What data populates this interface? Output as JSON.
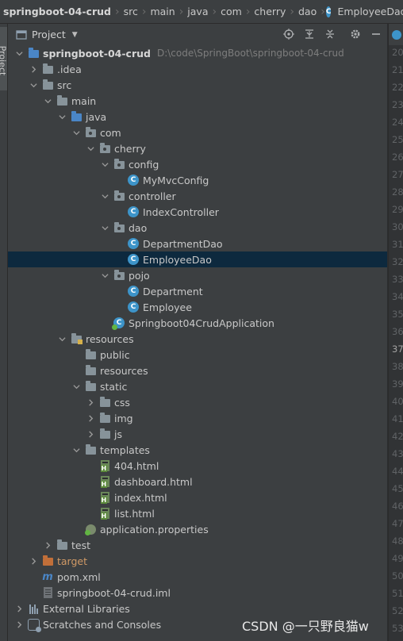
{
  "breadcrumb": [
    "springboot-04-crud",
    "src",
    "main",
    "java",
    "com",
    "cherry",
    "dao",
    "EmployeeDao"
  ],
  "tool_window": {
    "strip_label": "Project",
    "title": "Project"
  },
  "tree": [
    {
      "label": "springboot-04-crud",
      "path": "D:\\code\\SpringBoot\\springboot-04-crud",
      "depth": 0,
      "arrow": "down",
      "icon": "module-folder-icon",
      "bold": true
    },
    {
      "label": ".idea",
      "depth": 1,
      "arrow": "right",
      "icon": "folder-icon"
    },
    {
      "label": "src",
      "depth": 1,
      "arrow": "down",
      "icon": "folder-icon"
    },
    {
      "label": "main",
      "depth": 2,
      "arrow": "down",
      "icon": "folder-icon"
    },
    {
      "label": "java",
      "depth": 3,
      "arrow": "down",
      "icon": "source-folder-icon"
    },
    {
      "label": "com",
      "depth": 4,
      "arrow": "down",
      "icon": "package-icon"
    },
    {
      "label": "cherry",
      "depth": 5,
      "arrow": "down",
      "icon": "package-icon"
    },
    {
      "label": "config",
      "depth": 6,
      "arrow": "down",
      "icon": "package-icon"
    },
    {
      "label": "MyMvcConfig",
      "depth": 7,
      "arrow": "none",
      "icon": "class-icon"
    },
    {
      "label": "controller",
      "depth": 6,
      "arrow": "down",
      "icon": "package-icon"
    },
    {
      "label": "IndexController",
      "depth": 7,
      "arrow": "none",
      "icon": "class-icon"
    },
    {
      "label": "dao",
      "depth": 6,
      "arrow": "down",
      "icon": "package-icon"
    },
    {
      "label": "DepartmentDao",
      "depth": 7,
      "arrow": "none",
      "icon": "class-icon"
    },
    {
      "label": "EmployeeDao",
      "depth": 7,
      "arrow": "none",
      "icon": "class-icon",
      "selected": true
    },
    {
      "label": "pojo",
      "depth": 6,
      "arrow": "down",
      "icon": "package-icon"
    },
    {
      "label": "Department",
      "depth": 7,
      "arrow": "none",
      "icon": "class-icon"
    },
    {
      "label": "Employee",
      "depth": 7,
      "arrow": "none",
      "icon": "class-icon"
    },
    {
      "label": "Springboot04CrudApplication",
      "depth": 6,
      "arrow": "none",
      "icon": "spring-app-icon"
    },
    {
      "label": "resources",
      "depth": 3,
      "arrow": "down",
      "icon": "resources-folder-icon"
    },
    {
      "label": "public",
      "depth": 4,
      "arrow": "none",
      "icon": "folder-icon"
    },
    {
      "label": "resources",
      "depth": 4,
      "arrow": "none",
      "icon": "folder-icon"
    },
    {
      "label": "static",
      "depth": 4,
      "arrow": "down",
      "icon": "folder-icon"
    },
    {
      "label": "css",
      "depth": 5,
      "arrow": "right",
      "icon": "folder-icon"
    },
    {
      "label": "img",
      "depth": 5,
      "arrow": "right",
      "icon": "folder-icon"
    },
    {
      "label": "js",
      "depth": 5,
      "arrow": "right",
      "icon": "folder-icon"
    },
    {
      "label": "templates",
      "depth": 4,
      "arrow": "down",
      "icon": "folder-icon"
    },
    {
      "label": "404.html",
      "depth": 5,
      "arrow": "none",
      "icon": "html-file-icon"
    },
    {
      "label": "dashboard.html",
      "depth": 5,
      "arrow": "none",
      "icon": "html-file-icon"
    },
    {
      "label": "index.html",
      "depth": 5,
      "arrow": "none",
      "icon": "html-file-icon"
    },
    {
      "label": "list.html",
      "depth": 5,
      "arrow": "none",
      "icon": "html-file-icon"
    },
    {
      "label": "application.properties",
      "depth": 4,
      "arrow": "none",
      "icon": "properties-file-icon"
    },
    {
      "label": "test",
      "depth": 2,
      "arrow": "right",
      "icon": "folder-icon"
    },
    {
      "label": "target",
      "depth": 1,
      "arrow": "right",
      "icon": "excluded-folder-icon"
    },
    {
      "label": "pom.xml",
      "depth": 1,
      "arrow": "none",
      "icon": "maven-icon"
    },
    {
      "label": "springboot-04-crud.iml",
      "depth": 1,
      "arrow": "none",
      "icon": "iml-file-icon"
    },
    {
      "label": "External Libraries",
      "depth": 0,
      "arrow": "right",
      "icon": "libraries-icon"
    },
    {
      "label": "Scratches and Consoles",
      "depth": 0,
      "arrow": "right",
      "icon": "scratches-icon"
    }
  ],
  "line_numbers": [
    "20",
    "21",
    "22",
    "23",
    "24",
    "25",
    "26",
    "27",
    "28",
    "29",
    "30",
    "31",
    "32",
    "33",
    "34",
    "35",
    "36",
    "37",
    "38",
    "39",
    "40",
    "41",
    "42",
    "43",
    "44",
    "45",
    "46",
    "47",
    "48",
    "49",
    "50",
    "51",
    "52",
    "53"
  ],
  "current_line": "37",
  "watermark": "CSDN @一只野良猫w"
}
